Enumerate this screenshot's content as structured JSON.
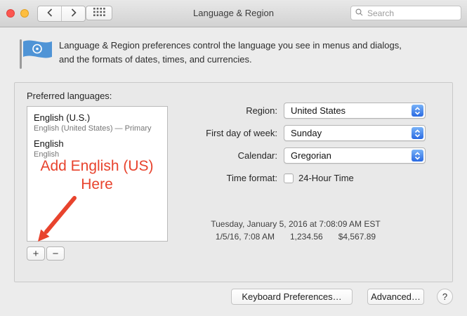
{
  "titlebar": {
    "title": "Language & Region",
    "search_placeholder": "Search"
  },
  "header": {
    "description_line1": "Language & Region preferences control the language you see in menus and dialogs,",
    "description_line2": "and the formats of dates, times, and currencies."
  },
  "preferred_languages": {
    "label": "Preferred languages:",
    "items": [
      {
        "name": "English (U.S.)",
        "subtitle": "English (United States) — Primary"
      },
      {
        "name": "English",
        "subtitle": "English"
      }
    ],
    "add_label": "+",
    "remove_label": "−"
  },
  "annotation": {
    "line1": "Add English (US)",
    "line2": "Here",
    "color": "#e8432d"
  },
  "settings": {
    "region": {
      "label": "Region:",
      "value": "United States"
    },
    "first_day": {
      "label": "First day of week:",
      "value": "Sunday"
    },
    "calendar": {
      "label": "Calendar:",
      "value": "Gregorian"
    },
    "time_format": {
      "label": "Time format:",
      "checkbox_label": "24-Hour Time",
      "checked": false
    }
  },
  "preview": {
    "line1": "Tuesday, January 5, 2016 at 7:08:09 AM EST",
    "line2_date": "1/5/16, 7:08 AM",
    "line2_number": "1,234.56",
    "line2_currency": "$4,567.89"
  },
  "footer": {
    "keyboard_button": "Keyboard Preferences…",
    "advanced_button": "Advanced…",
    "help_button": "?"
  },
  "colors": {
    "accent_blue": "#2a6ae2",
    "annotation_red": "#e8432d"
  }
}
